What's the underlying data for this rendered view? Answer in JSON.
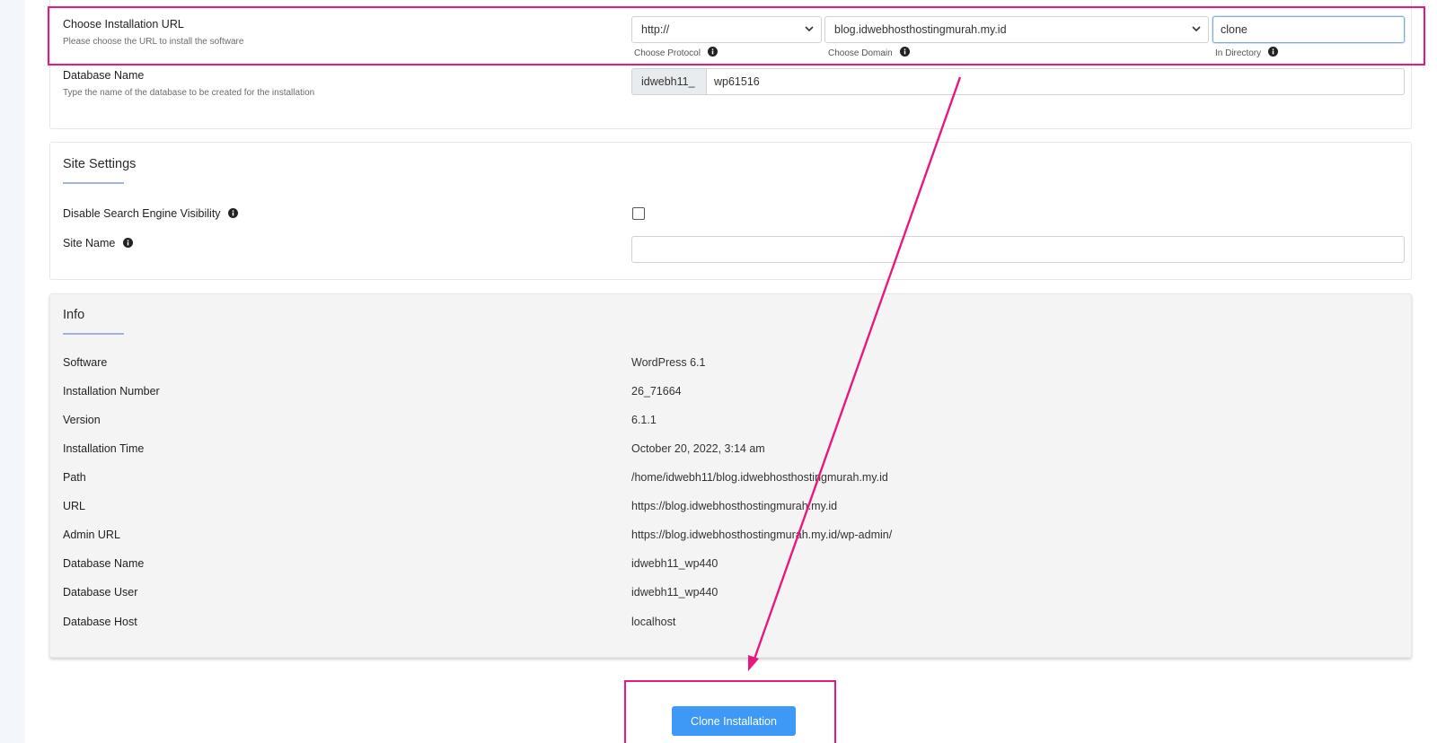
{
  "install_url": {
    "label": "Choose Installation URL",
    "description": "Please choose the URL to install the software",
    "protocol_value": "http://",
    "protocol_caption": "Choose Protocol",
    "domain_value": "blog.idwebhosthostingmurah.my.id",
    "domain_caption": "Choose Domain",
    "directory_value": "clone",
    "directory_caption": "In Directory"
  },
  "database": {
    "label": "Database Name",
    "description": "Type the name of the database to be created for the installation",
    "prefix": "idwebh11_",
    "value": "wp61516"
  },
  "site_settings": {
    "title": "Site Settings",
    "disable_search_label": "Disable Search Engine Visibility",
    "disable_search_checked": false,
    "site_name_label": "Site Name",
    "site_name_value": ""
  },
  "info": {
    "title": "Info",
    "rows": [
      {
        "label": "Software",
        "value": "WordPress 6.1"
      },
      {
        "label": "Installation Number",
        "value": "26_71664"
      },
      {
        "label": "Version",
        "value": "6.1.1"
      },
      {
        "label": "Installation Time",
        "value": "October 20, 2022, 3:14 am"
      },
      {
        "label": "Path",
        "value": "/home/idwebh11/blog.idwebhosthostingmurah.my.id"
      },
      {
        "label": "URL",
        "value": "https://blog.idwebhosthostingmurah.my.id"
      },
      {
        "label": "Admin URL",
        "value": "https://blog.idwebhosthostingmurah.my.id/wp-admin/"
      },
      {
        "label": "Database Name",
        "value": "idwebh11_wp440"
      },
      {
        "label": "Database User",
        "value": "idwebh11_wp440"
      },
      {
        "label": "Database Host",
        "value": "localhost"
      }
    ]
  },
  "actions": {
    "clone_label": "Clone Installation"
  },
  "colors": {
    "highlight": "#e8197e",
    "button": "#3d99f5",
    "focus_border": "#7fa8e0"
  }
}
